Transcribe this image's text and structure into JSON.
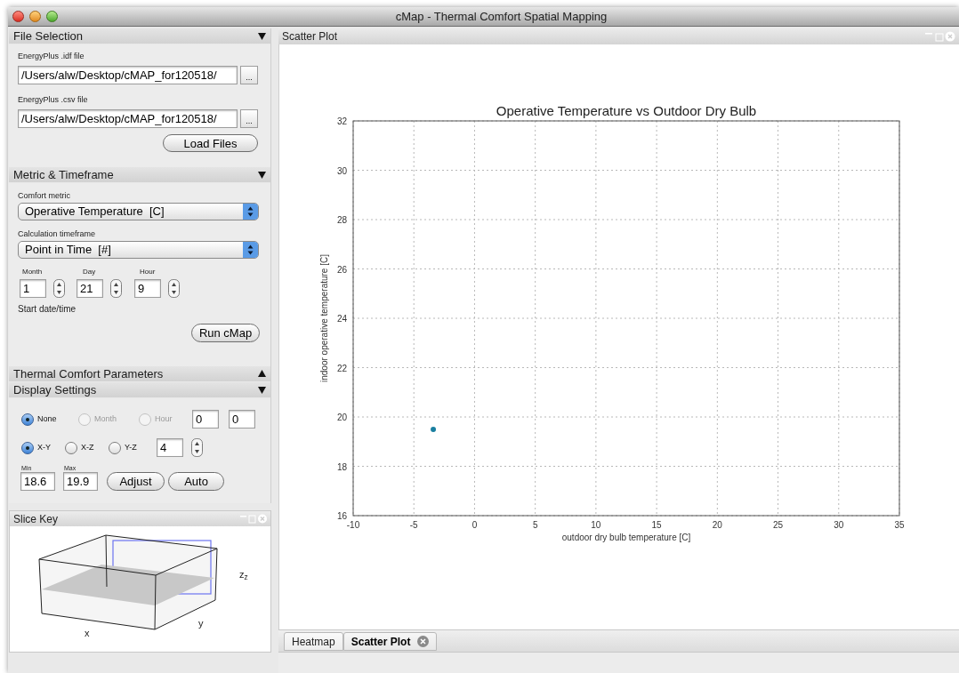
{
  "window": {
    "title": "cMap - Thermal Comfort Spatial Mapping"
  },
  "file_selection": {
    "title": "File Selection",
    "expanded": true,
    "fields": [
      {
        "label": "EnergyPlus .idf file",
        "value": "/Users/alw/Desktop/cMAP_for120518/",
        "button": "..."
      },
      {
        "label": "EnergyPlus .csv file",
        "value": "/Users/alw/Desktop/cMAP_for120518/",
        "button": "..."
      }
    ],
    "load_button": "Load Files"
  },
  "metric_timeframe": {
    "title": "Metric & Timeframe",
    "expanded": true,
    "selects": [
      {
        "label": "Comfort metric",
        "value": "Operative Temperature  [C]"
      },
      {
        "label": "Calculation timeframe",
        "value": "Point in Time  [#]"
      }
    ],
    "date_fields": [
      {
        "label": "Month",
        "value": "1"
      },
      {
        "label": "Day",
        "value": "21"
      },
      {
        "label": "Hour",
        "value": "9"
      }
    ],
    "caption": "Start date/time",
    "run_button": "Run cMap"
  },
  "thermal_comfort": {
    "title": "Thermal Comfort Parameters",
    "expanded": false
  },
  "display_settings": {
    "title": "Display Settings",
    "expanded": true,
    "time_radios": [
      {
        "label": "None",
        "selected": true,
        "disabled": false
      },
      {
        "label": "Month",
        "selected": false,
        "disabled": true
      },
      {
        "label": "Hour",
        "selected": false,
        "disabled": true
      }
    ],
    "time_fields": [
      "0",
      "0"
    ],
    "plane_radios": [
      {
        "label": "X-Y",
        "selected": true
      },
      {
        "label": "X-Z",
        "selected": false
      },
      {
        "label": "Y-Z",
        "selected": false
      }
    ],
    "slice_field": "4",
    "range_fields": [
      {
        "label": "Min",
        "value": "18.6"
      },
      {
        "label": "Max",
        "value": "19.9"
      }
    ],
    "buttons": [
      "Adjust",
      "Auto"
    ]
  },
  "slice_key": {
    "title": "Slice Key",
    "axis_labels": {
      "x": "x",
      "y": "y",
      "z": "z$_{z}$"
    }
  },
  "plot_panel": {
    "title": "Scatter Plot",
    "chart_data": {
      "type": "scatter",
      "title": "Operative Temperature vs Outdoor Dry Bulb",
      "xlabel": "outdoor dry bulb temperature [C]",
      "ylabel": "indoor operative temperature [C]",
      "x": [
        -3.4
      ],
      "series": [
        {
          "color": "#1a7fa0",
          "values": [
            19.5
          ]
        }
      ],
      "grid": true,
      "xlim": [
        -10,
        35
      ],
      "ylim": [
        16,
        32
      ],
      "xticks": [
        -10,
        -5,
        0,
        5,
        10,
        15,
        20,
        25,
        30,
        35
      ],
      "yticks": [
        16,
        18,
        20,
        22,
        24,
        26,
        28,
        30,
        32
      ]
    }
  },
  "tabs": [
    {
      "label": "Heatmap",
      "selected": false,
      "closable": false
    },
    {
      "label": "Scatter Plot",
      "selected": true,
      "closable": true
    }
  ]
}
